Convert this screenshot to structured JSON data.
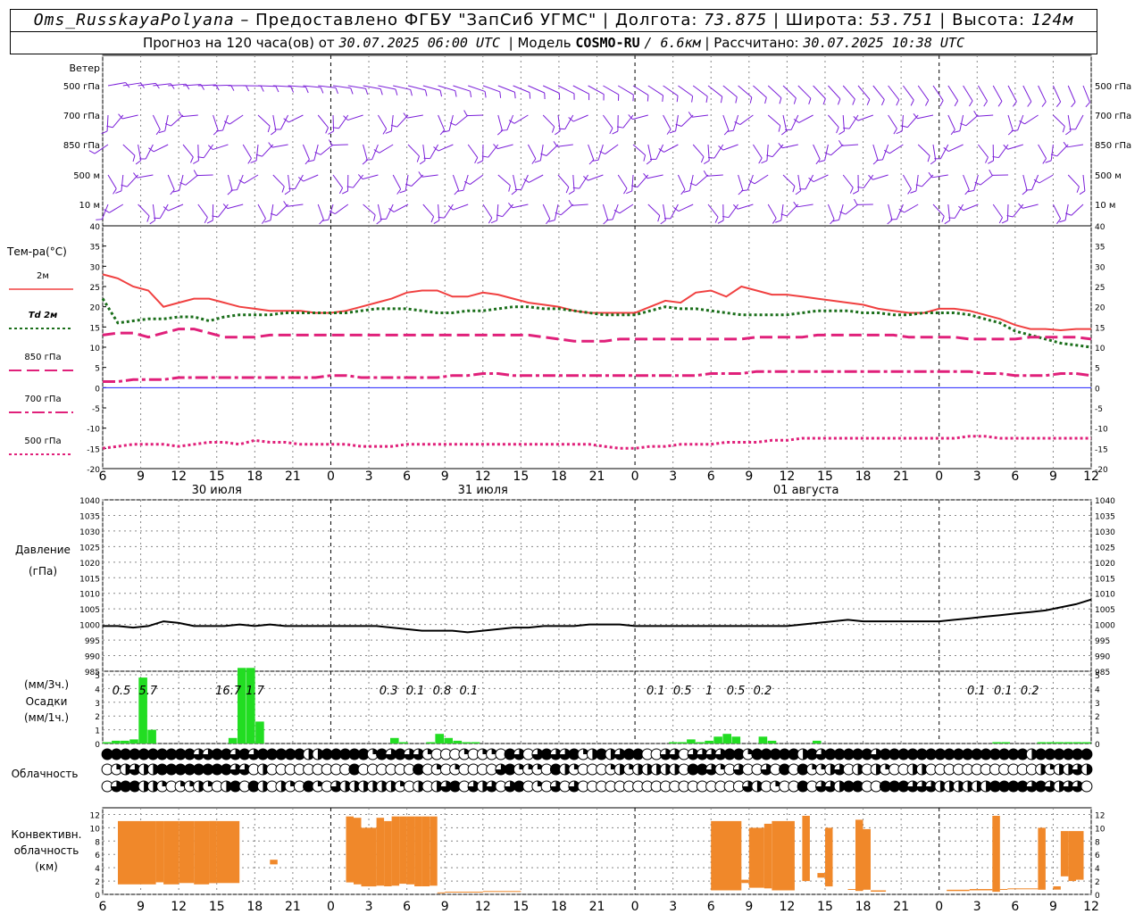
{
  "header": {
    "station": "Oms_RusskayaPolyana",
    "provided_by": "Предоставлено ФГБУ \"ЗапСиб УГМС\"",
    "lon_label": "Долгота:",
    "lon": "73.875",
    "lat_label": "Широта:",
    "lat": "53.751",
    "alt_label": "Высота:",
    "alt": "124м",
    "forecast_label": "Прогноз на 120 часа(ов) от",
    "forecast_from": "30.07.2025 06:00 UTC",
    "model_label": "Модель",
    "model": "COSMO-RU",
    "model_res": "/ 6.6км",
    "calc_label": "Рассчитано:",
    "calc_time": "30.07.2025 10:38 UTC",
    "sep": "|",
    "dash": "–"
  },
  "colors": {
    "wind": "#7b1fd9",
    "t2m": "#f04040",
    "td": "#1a6e1a",
    "t850": "#e0207a",
    "t700": "#e0207a",
    "t500": "#e0207a",
    "zero": "#2020ff",
    "precip": "#22dd22",
    "convective": "#f0882a"
  },
  "chart_data": [
    {
      "type": "wind_barbs",
      "title": "Ветер",
      "levels": [
        "500 гПа",
        "700 гПа",
        "850 гПа",
        "500 м",
        "10 м"
      ]
    },
    {
      "type": "line",
      "title": "Тем-ра(°C)",
      "ylim": [
        -20,
        40
      ],
      "yticks": [
        40,
        35,
        30,
        25,
        20,
        15,
        10,
        5,
        0,
        -5,
        -10,
        -15,
        -20
      ],
      "x_hours": [
        "6",
        "9",
        "12",
        "15",
        "18",
        "21",
        "0",
        "3",
        "6",
        "9",
        "12",
        "15",
        "18",
        "21",
        "0",
        "3",
        "6",
        "9",
        "12",
        "15",
        "18",
        "21",
        "0",
        "3",
        "6",
        "9",
        "12"
      ],
      "dates": [
        "30 июля",
        "31 июля",
        "01 августа"
      ],
      "legend": [
        {
          "key": "t2m",
          "label": "2м"
        },
        {
          "key": "td",
          "label": "Td",
          "label2": "2м"
        },
        {
          "key": "t850",
          "label": "850 гПа"
        },
        {
          "key": "t700",
          "label": "700 гПа"
        },
        {
          "key": "t500",
          "label": "500 гПа"
        }
      ],
      "series": [
        {
          "key": "t2m",
          "values": [
            28,
            27,
            25,
            24,
            20,
            21,
            22,
            22,
            21,
            20,
            19.5,
            19,
            19,
            19,
            18.5,
            18.5,
            19,
            20,
            21,
            22,
            23.5,
            24,
            24,
            22.5,
            22.5,
            23.5,
            23,
            22,
            21,
            20.5,
            20,
            19,
            18.5,
            18.5,
            18.5,
            18.5,
            20,
            21.5,
            21,
            23.5,
            24,
            22.5,
            25,
            24,
            23,
            23,
            22.5,
            22,
            21.5,
            21,
            20.5,
            19.5,
            19,
            18.5,
            18.5,
            19.5,
            19.5,
            19,
            18,
            17,
            15.5,
            14.5,
            14.5,
            14.2,
            14.5,
            14.5
          ]
        },
        {
          "key": "td",
          "values": [
            22,
            16,
            16.5,
            17,
            17,
            17.5,
            17.5,
            16.5,
            17.5,
            18,
            18,
            18,
            18.5,
            18.5,
            18.5,
            18.5,
            18.5,
            19,
            19.5,
            19.5,
            19.5,
            19,
            18.5,
            18.5,
            19,
            19,
            19.5,
            20,
            20,
            19.5,
            19.5,
            19,
            18.5,
            18,
            18,
            18,
            19,
            20,
            19.5,
            19.5,
            19,
            18.5,
            18,
            18,
            18,
            18,
            18.5,
            19,
            19,
            19,
            18.5,
            18.5,
            18,
            18,
            18.5,
            18.5,
            18.5,
            18,
            17,
            16,
            14,
            13,
            12,
            11,
            10.5,
            10
          ]
        },
        {
          "key": "t850",
          "values": [
            13,
            13.5,
            13.5,
            12.5,
            13.5,
            14.5,
            14.5,
            13.5,
            12.5,
            12.5,
            12.5,
            13,
            13,
            13,
            13,
            13,
            13,
            13,
            13,
            13,
            13,
            13,
            13,
            13,
            13,
            13,
            13,
            13,
            13,
            12.5,
            12,
            11.5,
            11.5,
            11.5,
            12,
            12,
            12,
            12,
            12,
            12,
            12,
            12,
            12,
            12.5,
            12.5,
            12.5,
            12.5,
            13,
            13,
            13,
            13,
            13,
            13,
            12.5,
            12.5,
            12.5,
            12.5,
            12,
            12,
            12,
            12,
            12.5,
            12.5,
            12.5,
            12.5,
            12
          ]
        },
        {
          "key": "t700",
          "values": [
            1.5,
            1.5,
            2,
            2,
            2,
            2.5,
            2.5,
            2.5,
            2.5,
            2.5,
            2.5,
            2.5,
            2.5,
            2.5,
            2.5,
            3,
            3,
            2.5,
            2.5,
            2.5,
            2.5,
            2.5,
            2.5,
            3,
            3,
            3.5,
            3.5,
            3,
            3,
            3,
            3,
            3,
            3,
            3,
            3,
            3,
            3,
            3,
            3,
            3,
            3.5,
            3.5,
            3.5,
            4,
            4,
            4,
            4,
            4,
            4,
            4,
            4,
            4,
            4,
            4,
            4,
            4,
            4,
            4,
            3.5,
            3.5,
            3,
            3,
            3,
            3.5,
            3.5,
            3
          ]
        },
        {
          "key": "t500",
          "values": [
            -15,
            -14.5,
            -14,
            -14,
            -14,
            -14.5,
            -14,
            -13.5,
            -13.5,
            -14,
            -13,
            -13.5,
            -13.5,
            -14,
            -14,
            -14,
            -14,
            -14.5,
            -14.5,
            -14.5,
            -14,
            -14,
            -14,
            -14,
            -14,
            -14,
            -14,
            -14,
            -14,
            -14,
            -14,
            -14,
            -14,
            -14.5,
            -15,
            -15,
            -14.5,
            -14.5,
            -14,
            -14,
            -14,
            -13.5,
            -13.5,
            -13.5,
            -13,
            -13,
            -12.5,
            -12.5,
            -12.5,
            -12.5,
            -12.5,
            -12.5,
            -12.5,
            -12.5,
            -12.5,
            -12.5,
            -12.5,
            -12,
            -12,
            -12.5,
            -12.5,
            -12.5,
            -12.5,
            -12.5,
            -12.5,
            -12.5
          ]
        }
      ]
    },
    {
      "type": "line",
      "title": "Давление",
      "units": "(гПа)",
      "ylim": [
        985,
        1040
      ],
      "yticks": [
        1040,
        1035,
        1030,
        1025,
        1020,
        1015,
        1010,
        1005,
        1000,
        995,
        990,
        985
      ],
      "series": [
        {
          "key": "pressure",
          "values": [
            999.5,
            999.5,
            999,
            999.5,
            1001,
            1000.5,
            999.5,
            999.5,
            999.5,
            1000,
            999.5,
            1000,
            999.5,
            999.5,
            999.5,
            999.5,
            999.5,
            999.5,
            999.5,
            999,
            998.5,
            998,
            998,
            998,
            997.5,
            998,
            998.5,
            999,
            999,
            999.5,
            999.5,
            999.5,
            1000,
            1000,
            1000,
            999.5,
            999.5,
            999.5,
            999.5,
            999.5,
            999.5,
            999.5,
            999.5,
            999.5,
            999.5,
            999.5,
            1000,
            1000.5,
            1001,
            1001.5,
            1001,
            1001,
            1001,
            1001,
            1001,
            1001,
            1001.5,
            1002,
            1002.5,
            1003,
            1003.5,
            1004,
            1004.5,
            1005.5,
            1006.5,
            1008
          ]
        }
      ]
    },
    {
      "type": "bar",
      "title": "Осадки",
      "units_3h": "(мм/3ч.)",
      "units_1h": "(мм/1ч.)",
      "ylim": [
        0,
        5
      ],
      "yticks": [
        5,
        4,
        3,
        2,
        1,
        0
      ],
      "hourly_values": [
        0.1,
        0.2,
        0.2,
        0.3,
        4.8,
        1,
        0,
        0,
        0,
        0,
        0,
        0,
        0,
        0,
        0.4,
        5.5,
        6,
        1.6,
        0,
        0,
        0,
        0,
        0,
        0,
        0,
        0,
        0,
        0,
        0,
        0,
        0,
        0,
        0.4,
        0.1,
        0,
        0,
        0.1,
        0.7,
        0.4,
        0.2,
        0.1,
        0.1,
        0,
        0,
        0,
        0,
        0,
        0,
        0,
        0,
        0,
        0,
        0,
        0,
        0,
        0,
        0,
        0,
        0,
        0,
        0,
        0,
        0,
        0.1,
        0.1,
        0.3,
        0.1,
        0.2,
        0.5,
        0.7,
        0.5,
        0,
        0,
        0.5,
        0.2,
        0,
        0,
        0,
        0,
        0.2,
        0,
        0,
        0,
        0,
        0,
        0,
        0,
        0,
        0,
        0,
        0,
        0,
        0,
        0,
        0,
        0,
        0,
        0,
        0,
        0.1,
        0.1,
        0,
        0,
        0,
        0.1,
        0.1,
        0.1,
        0.1,
        0.1,
        0.1
      ],
      "totals_3h": [
        {
          "slot": 1,
          "value": "0.5"
        },
        {
          "slot": 2,
          "value": "5.7"
        },
        {
          "slot": 5,
          "value": "16.7"
        },
        {
          "slot": 6,
          "value": "1.7"
        },
        {
          "slot": 11,
          "value": "0.3"
        },
        {
          "slot": 12,
          "value": "0.1"
        },
        {
          "slot": 13,
          "value": "0.8"
        },
        {
          "slot": 14,
          "value": "0.1"
        },
        {
          "slot": 21,
          "value": "0.1"
        },
        {
          "slot": 22,
          "value": "0.5"
        },
        {
          "slot": 23,
          "value": "1"
        },
        {
          "slot": 24,
          "value": "0.5"
        },
        {
          "slot": 25,
          "value": "0.2"
        },
        {
          "slot": 33,
          "value": "0.1"
        },
        {
          "slot": 34,
          "value": "0.1"
        },
        {
          "slot": 35,
          "value": "0.2"
        }
      ]
    },
    {
      "type": "symbols",
      "title": "Облачность",
      "rows": [
        "444444444433443434444422444441434331000101104303433412423440033033334414444424344444344444444444444442444444",
        "012322444444443302000000000400000040101000034111042100012122222044310300304041123020210022000000000000212232",
        "034422101121024042021041032222221020234032303401030300000000000000000032010040332440044433322222244443432330"
      ]
    },
    {
      "type": "range_bar",
      "title": "Конвективн.",
      "title2": "облачность",
      "units": "(км)",
      "ylim": [
        0,
        13
      ],
      "yticks": [
        12,
        10,
        8,
        6,
        4,
        2,
        0
      ],
      "bars": [
        {
          "x0": 2,
          "x1": 7,
          "bottom": 1.5,
          "top": 11
        },
        {
          "x0": 7,
          "x1": 8,
          "bottom": 1.8,
          "top": 11
        },
        {
          "x0": 8,
          "x1": 10,
          "bottom": 1.5,
          "top": 11
        },
        {
          "x0": 10,
          "x1": 12,
          "bottom": 1.7,
          "top": 11
        },
        {
          "x0": 12,
          "x1": 14,
          "bottom": 1.5,
          "top": 11
        },
        {
          "x0": 14,
          "x1": 15,
          "bottom": 1.7,
          "top": 11
        },
        {
          "x0": 14,
          "x1": 15,
          "bottom": 1.7,
          "top": 11
        },
        {
          "x0": 15,
          "x1": 18,
          "bottom": 1.7,
          "top": 11
        },
        {
          "x0": 22,
          "x1": 23,
          "bottom": 4.5,
          "top": 5.2
        },
        {
          "x0": 32,
          "x1": 33,
          "bottom": 1.8,
          "top": 11.7
        },
        {
          "x0": 33,
          "x1": 34,
          "bottom": 1.5,
          "top": 11.5
        },
        {
          "x0": 34,
          "x1": 36,
          "bottom": 1.2,
          "top": 10
        },
        {
          "x0": 36,
          "x1": 37,
          "bottom": 1.3,
          "top": 11.5
        },
        {
          "x0": 37,
          "x1": 38,
          "bottom": 1.2,
          "top": 11
        },
        {
          "x0": 38,
          "x1": 39,
          "bottom": 1.3,
          "top": 11.7
        },
        {
          "x0": 39,
          "x1": 40,
          "bottom": 1.6,
          "top": 11.7
        },
        {
          "x0": 40,
          "x1": 41,
          "bottom": 1.5,
          "top": 11.7
        },
        {
          "x0": 41,
          "x1": 42,
          "bottom": 1.2,
          "top": 11.7
        },
        {
          "x0": 42,
          "x1": 43,
          "bottom": 1.2,
          "top": 11.7
        },
        {
          "x0": 43,
          "x1": 44,
          "bottom": 1.3,
          "top": 11.7
        },
        {
          "x0": 44,
          "x1": 45,
          "bottom": 0.2,
          "top": 0.3
        },
        {
          "x0": 45,
          "x1": 50,
          "bottom": 0.3,
          "top": 0.4
        },
        {
          "x0": 50,
          "x1": 55,
          "bottom": 0.4,
          "top": 0.5
        },
        {
          "x0": 80,
          "x1": 84,
          "bottom": 0.6,
          "top": 11
        },
        {
          "x0": 84,
          "x1": 85,
          "bottom": 1.7,
          "top": 2.2
        },
        {
          "x0": 85,
          "x1": 87,
          "bottom": 1,
          "top": 10
        },
        {
          "x0": 87,
          "x1": 88,
          "bottom": 0.9,
          "top": 10.6
        },
        {
          "x0": 88,
          "x1": 91,
          "bottom": 0.6,
          "top": 11
        },
        {
          "x0": 92,
          "x1": 93,
          "bottom": 2,
          "top": 11.8
        },
        {
          "x0": 94,
          "x1": 95,
          "bottom": 2.5,
          "top": 3.2
        },
        {
          "x0": 95,
          "x1": 96,
          "bottom": 1.2,
          "top": 10
        },
        {
          "x0": 98,
          "x1": 99,
          "bottom": 0.7,
          "top": 0.8
        },
        {
          "x0": 99,
          "x1": 100,
          "bottom": 0.5,
          "top": 11.2
        },
        {
          "x0": 100,
          "x1": 101,
          "bottom": 0.7,
          "top": 9.8
        },
        {
          "x0": 101,
          "x1": 103,
          "bottom": 0.4,
          "top": 0.6
        },
        {
          "x0": 111,
          "x1": 114,
          "bottom": 0.5,
          "top": 0.7
        },
        {
          "x0": 114,
          "x1": 117,
          "bottom": 0.6,
          "top": 0.8
        },
        {
          "x0": 117,
          "x1": 118,
          "bottom": 0.4,
          "top": 11.8
        },
        {
          "x0": 118,
          "x1": 119,
          "bottom": 0.7,
          "top": 0.8
        },
        {
          "x0": 119,
          "x1": 123,
          "bottom": 0.8,
          "top": 0.9
        },
        {
          "x0": 123,
          "x1": 124,
          "bottom": 0.7,
          "top": 10
        },
        {
          "x0": 125,
          "x1": 126,
          "bottom": 0.7,
          "top": 1.2
        },
        {
          "x0": 126,
          "x1": 127,
          "bottom": 2.7,
          "top": 9.5
        },
        {
          "x0": 127,
          "x1": 128,
          "bottom": 2,
          "top": 9.5
        },
        {
          "x0": 128,
          "x1": 129,
          "bottom": 2.2,
          "top": 9.5
        }
      ]
    }
  ]
}
